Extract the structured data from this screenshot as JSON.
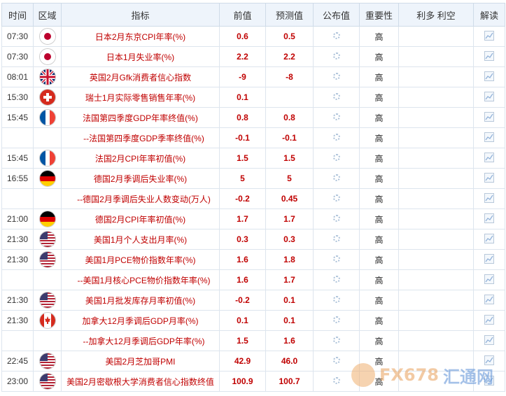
{
  "headers": {
    "time": "时间",
    "region": "区域",
    "indicator": "指标",
    "previous": "前值",
    "forecast": "预测值",
    "published": "公布值",
    "importance": "重要性",
    "impact": "利多 利空",
    "analysis": "解读"
  },
  "rows": [
    {
      "time": "07:30",
      "flag": "jp",
      "indicator": "日本2月东京CPI年率(%)",
      "previous": "0.6",
      "forecast": "0.5",
      "importance": "高"
    },
    {
      "time": "07:30",
      "flag": "jp",
      "indicator": "日本1月失业率(%)",
      "previous": "2.2",
      "forecast": "2.2",
      "importance": "高"
    },
    {
      "time": "08:01",
      "flag": "gb",
      "indicator": "英国2月Gfk消费者信心指数",
      "previous": "-9",
      "forecast": "-8",
      "importance": "高"
    },
    {
      "time": "15:30",
      "flag": "ch",
      "indicator": "瑞士1月实际零售销售年率(%)",
      "previous": "0.1",
      "forecast": "",
      "importance": "高"
    },
    {
      "time": "15:45",
      "flag": "fr",
      "indicator": "法国第四季度GDP年率终值(%)",
      "previous": "0.8",
      "forecast": "0.8",
      "importance": "高"
    },
    {
      "time": "",
      "flag": "",
      "indicator": "--法国第四季度GDP季率终值(%)",
      "previous": "-0.1",
      "forecast": "-0.1",
      "importance": "高"
    },
    {
      "time": "15:45",
      "flag": "fr",
      "indicator": "法国2月CPI年率初值(%)",
      "previous": "1.5",
      "forecast": "1.5",
      "importance": "高"
    },
    {
      "time": "16:55",
      "flag": "de",
      "indicator": "德国2月季调后失业率(%)",
      "previous": "5",
      "forecast": "5",
      "importance": "高"
    },
    {
      "time": "",
      "flag": "",
      "indicator": "--德国2月季调后失业人数变动(万人)",
      "previous": "-0.2",
      "forecast": "0.45",
      "importance": "高"
    },
    {
      "time": "21:00",
      "flag": "de",
      "indicator": "德国2月CPI年率初值(%)",
      "previous": "1.7",
      "forecast": "1.7",
      "importance": "高"
    },
    {
      "time": "21:30",
      "flag": "us",
      "indicator": "美国1月个人支出月率(%)",
      "previous": "0.3",
      "forecast": "0.3",
      "importance": "高"
    },
    {
      "time": "21:30",
      "flag": "us",
      "indicator": "美国1月PCE物价指数年率(%)",
      "previous": "1.6",
      "forecast": "1.8",
      "importance": "高"
    },
    {
      "time": "",
      "flag": "",
      "indicator": "--美国1月核心PCE物价指数年率(%)",
      "previous": "1.6",
      "forecast": "1.7",
      "importance": "高"
    },
    {
      "time": "21:30",
      "flag": "us",
      "indicator": "美国1月批发库存月率初值(%)",
      "previous": "-0.2",
      "forecast": "0.1",
      "importance": "高"
    },
    {
      "time": "21:30",
      "flag": "ca",
      "indicator": "加拿大12月季调后GDP月率(%)",
      "previous": "0.1",
      "forecast": "0.1",
      "importance": "高"
    },
    {
      "time": "",
      "flag": "",
      "indicator": "--加拿大12月季调后GDP年率(%)",
      "previous": "1.5",
      "forecast": "1.6",
      "importance": "高"
    },
    {
      "time": "22:45",
      "flag": "us",
      "indicator": "美国2月芝加哥PMI",
      "previous": "42.9",
      "forecast": "46.0",
      "importance": "高"
    },
    {
      "time": "23:00",
      "flag": "us",
      "indicator": "美国2月密歇根大学消费者信心指数终值",
      "previous": "100.9",
      "forecast": "100.7",
      "importance": "高"
    }
  ],
  "watermark": {
    "latin": "FX678",
    "cn": "汇通网"
  },
  "colors": {
    "value_red": "#c00000",
    "header_bg": "#eef4fb",
    "border": "#dde5ee"
  }
}
